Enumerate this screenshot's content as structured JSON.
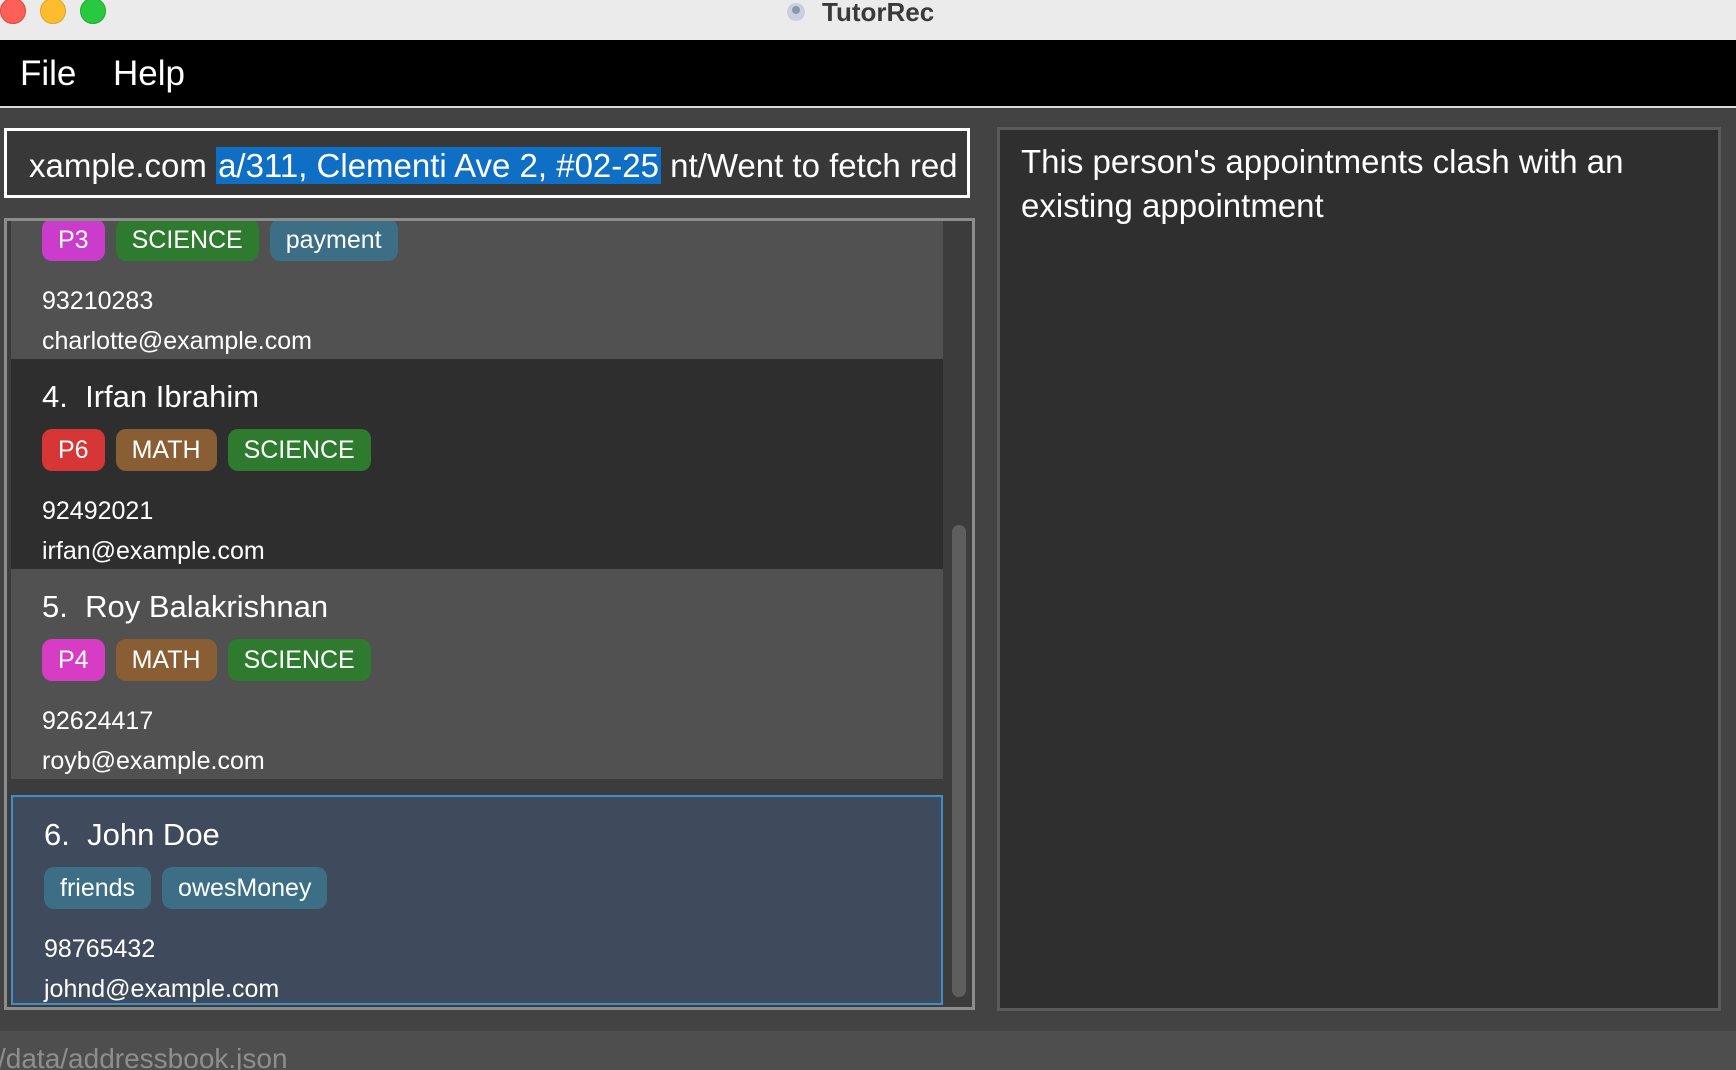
{
  "window": {
    "title": "TutorRec"
  },
  "menu": {
    "items": [
      "File",
      "Help"
    ]
  },
  "command": {
    "before": "xample.com ",
    "selected": "a/311, Clementi Ave 2, #02-25",
    "after": " nt/Went to fetch red"
  },
  "persons": [
    {
      "index": "",
      "name": "",
      "tags": [
        "P3",
        "SCIENCE",
        "payment"
      ],
      "phone": "93210283",
      "email": "charlotte@example.com"
    },
    {
      "index": "4.",
      "name": "Irfan Ibrahim",
      "tags": [
        "P6",
        "MATH",
        "SCIENCE"
      ],
      "phone": "92492021",
      "email": "irfan@example.com"
    },
    {
      "index": "5.",
      "name": "Roy Balakrishnan",
      "tags": [
        "P4",
        "MATH",
        "SCIENCE"
      ],
      "phone": "92624417",
      "email": "royb@example.com"
    },
    {
      "index": "6.",
      "name": "John Doe",
      "tags": [
        "friends",
        "owesMoney"
      ],
      "phone": "98765432",
      "email": "johnd@example.com"
    }
  ],
  "result": {
    "message": "This person's appointments clash with an existing appointment"
  },
  "status": {
    "path": "/data/addressbook.json"
  },
  "colors": {
    "selection": "#0e6fc4",
    "selected_card_border": "#3d8ec9",
    "tag_P3": "#cc3ccc",
    "tag_P4": "#d63cc4",
    "tag_P6": "#d73636",
    "tag_MATH": "#8a5e34",
    "tag_SCIENCE": "#2e7a2e",
    "tag_default": "#3c6e85"
  }
}
